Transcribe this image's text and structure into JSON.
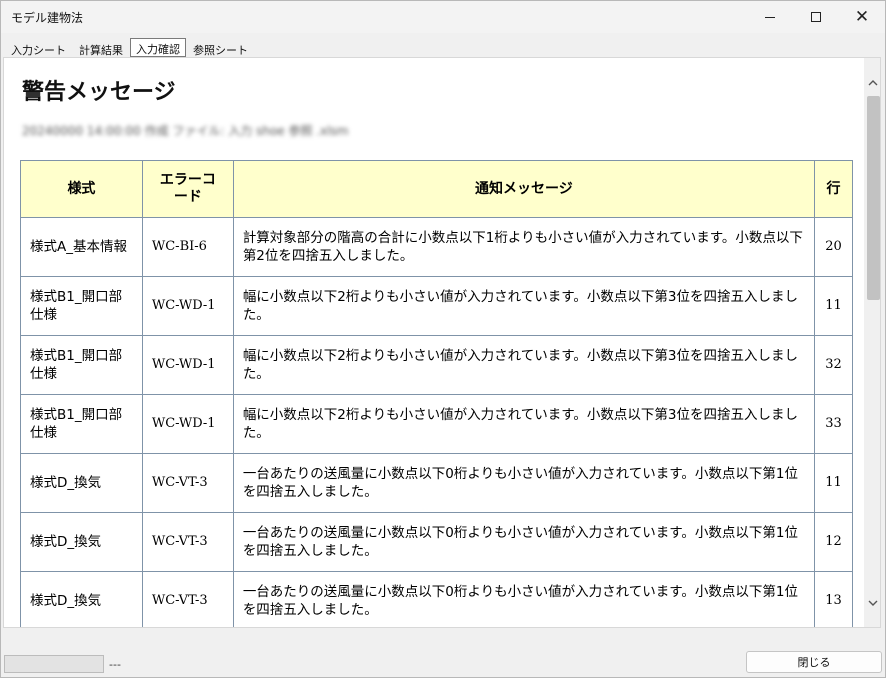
{
  "window": {
    "title": "モデル建物法"
  },
  "tabs": [
    {
      "label": "入力シート",
      "active": false
    },
    {
      "label": "計算結果",
      "active": false
    },
    {
      "label": "入力確認",
      "active": true
    },
    {
      "label": "参照シート",
      "active": false
    }
  ],
  "page": {
    "heading": "警告メッセージ",
    "blurred_line": "20240000 14:00:00  作成 ファイル: 入力 shoe 参照 .xlsm"
  },
  "table": {
    "headers": {
      "style": "様式",
      "code": "エラーコード",
      "message": "通知メッセージ",
      "row": "行"
    },
    "rows": [
      {
        "style": "様式A_基本情報",
        "code": "WC-BI-6",
        "message": "計算対象部分の階高の合計に小数点以下1桁よりも小さい値が入力されています。小数点以下第2位を四捨五入しました。",
        "row": "20"
      },
      {
        "style": "様式B1_開口部仕様",
        "code": "WC-WD-1",
        "message": "幅に小数点以下2桁よりも小さい値が入力されています。小数点以下第3位を四捨五入しました。",
        "row": "11"
      },
      {
        "style": "様式B1_開口部仕様",
        "code": "WC-WD-1",
        "message": "幅に小数点以下2桁よりも小さい値が入力されています。小数点以下第3位を四捨五入しました。",
        "row": "32"
      },
      {
        "style": "様式B1_開口部仕様",
        "code": "WC-WD-1",
        "message": "幅に小数点以下2桁よりも小さい値が入力されています。小数点以下第3位を四捨五入しました。",
        "row": "33"
      },
      {
        "style": "様式D_換気",
        "code": "WC-VT-3",
        "message": "一台あたりの送風量に小数点以下0桁よりも小さい値が入力されています。小数点以下第1位を四捨五入しました。",
        "row": "11"
      },
      {
        "style": "様式D_換気",
        "code": "WC-VT-3",
        "message": "一台あたりの送風量に小数点以下0桁よりも小さい値が入力されています。小数点以下第1位を四捨五入しました。",
        "row": "12"
      },
      {
        "style": "様式D_換気",
        "code": "WC-VT-3",
        "message": "一台あたりの送風量に小数点以下0桁よりも小さい値が入力されています。小数点以下第1位を四捨五入しました。",
        "row": "13"
      }
    ]
  },
  "statusbar": {
    "status_text": "---",
    "close_label": "閉じる"
  },
  "icons": {
    "minimize": "minimize-icon",
    "maximize": "maximize-icon",
    "close": "close-icon",
    "scroll_up": "chevron-up-icon",
    "scroll_down": "chevron-down-icon"
  }
}
